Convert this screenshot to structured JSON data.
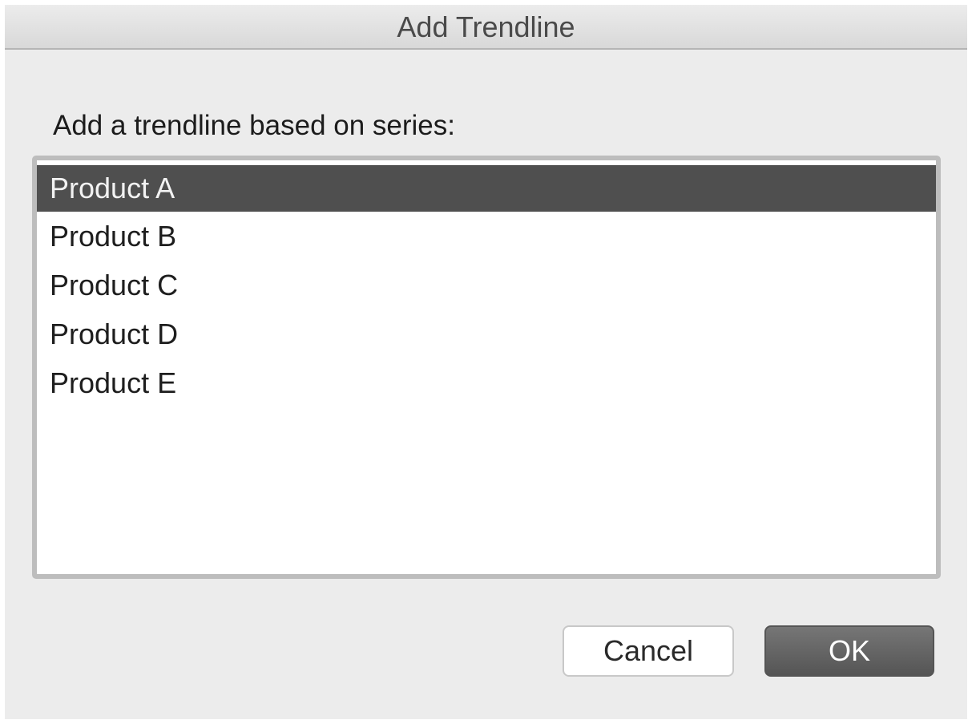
{
  "dialog": {
    "title": "Add Trendline",
    "prompt": "Add a trendline based on series:",
    "series": [
      {
        "label": "Product A",
        "selected": true
      },
      {
        "label": "Product B",
        "selected": false
      },
      {
        "label": "Product C",
        "selected": false
      },
      {
        "label": "Product D",
        "selected": false
      },
      {
        "label": "Product E",
        "selected": false
      }
    ],
    "buttons": {
      "cancel_label": "Cancel",
      "ok_label": "OK"
    }
  },
  "colors": {
    "selection": "#4f4f4f",
    "dialog_background": "#ececec",
    "ok_button": "#5f5f5f"
  }
}
